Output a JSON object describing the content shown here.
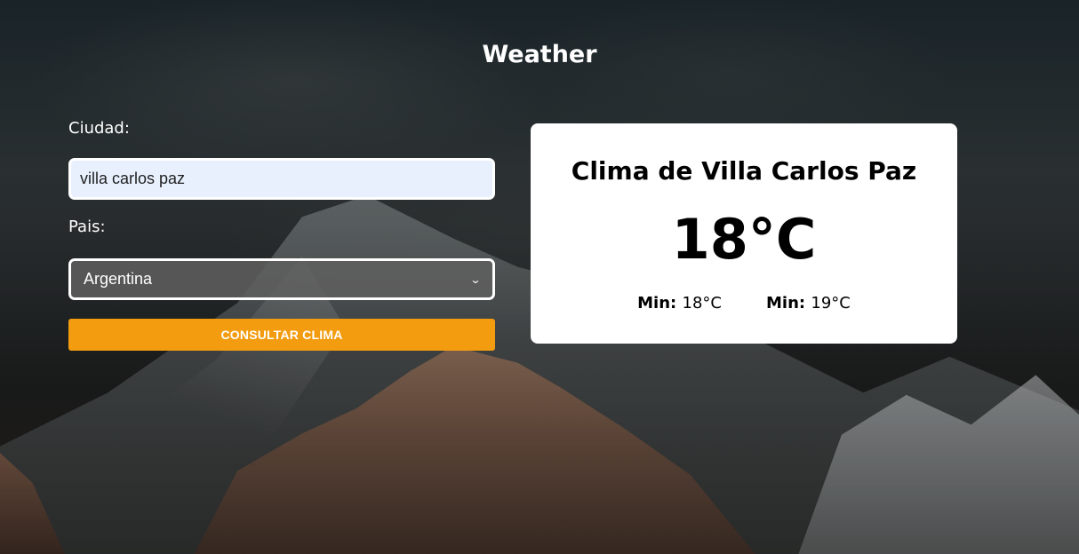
{
  "header": {
    "title": "Weather"
  },
  "form": {
    "city_label": "Ciudad:",
    "city_value": "villa carlos paz",
    "country_label": "Pais:",
    "country_selected": "Argentina",
    "submit_label": "CONSULTAR CLIMA"
  },
  "result": {
    "title": "Clima de Villa Carlos Paz",
    "temperature": "18°C",
    "min_label": "Min:",
    "min_value": "18°C",
    "max_label": "Min:",
    "max_value": "19°C"
  },
  "colors": {
    "accent": "#f39c0f",
    "card_bg": "#ffffff",
    "input_bg": "#e8f0fe"
  },
  "icons": {
    "select_arrow": "chevron-down-icon"
  }
}
